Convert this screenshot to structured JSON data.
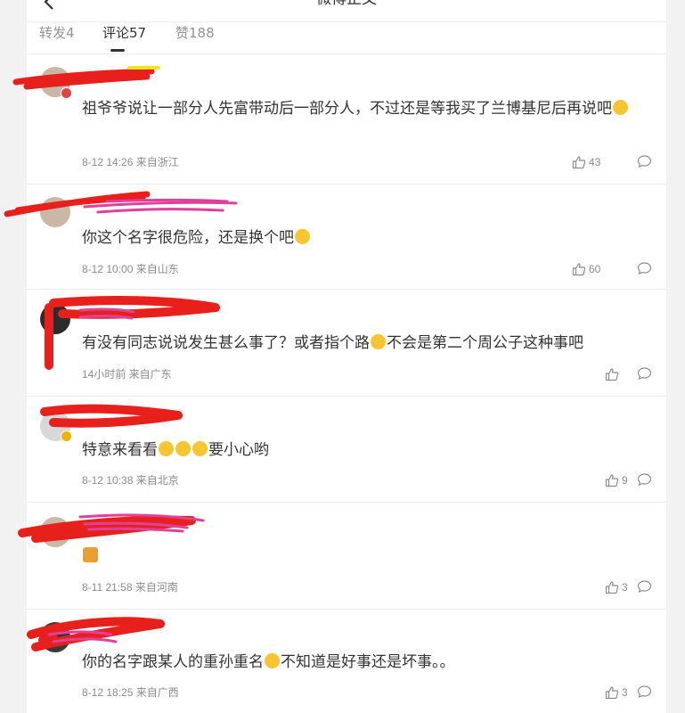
{
  "header": {
    "title": "微博正文"
  },
  "tabs": [
    {
      "label": "转发4"
    },
    {
      "label": "评论57"
    },
    {
      "label": "赞188"
    }
  ],
  "comments": [
    {
      "text_a": "祖爷爷说让一部分人先富带动后一部分人，不过还是等我买了兰博基尼后再说吧",
      "time": "8-12 14:26 来自浙江",
      "likes": "43"
    },
    {
      "text_a": "你这个名字很危险，还是换个吧",
      "time": "8-12 10:00 来自山东",
      "likes": "60"
    },
    {
      "text_a": "有没有同志说说发生甚么事了？或者指个路",
      "text_b": "不会是第二个周公子这种事吧",
      "time": "14小时前 来自广东",
      "likes": ""
    },
    {
      "text_a": "特意来看看",
      "text_b": "要小心哟",
      "time": "8-12 10:38 来自北京",
      "likes": "9"
    },
    {
      "text_a": "",
      "time": "8-11 21:58 来自河南",
      "likes": "3"
    },
    {
      "text_a": "你的名字跟某人的重孙重名",
      "text_b": "不知道是好事还是坏事。。",
      "time": "8-12 18:25 来自广西",
      "likes": "3"
    }
  ],
  "colors": {
    "redact_red": "#e8201c",
    "redact_pink": "#e0409a",
    "accent_yellow": "#f7c531"
  },
  "icons": {
    "like": "thumbs-up-icon",
    "reply": "comment-bubble-icon",
    "back": "chevron-left-icon"
  }
}
